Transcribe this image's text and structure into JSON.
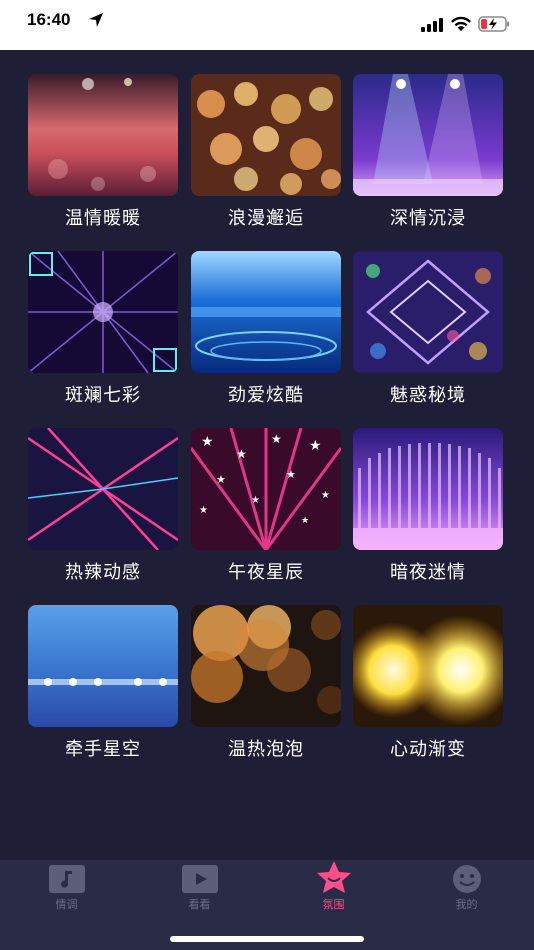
{
  "status_bar": {
    "time": "16:40"
  },
  "scenes": [
    {
      "label": "温情暖暖",
      "theme": "warm-pink-bokeh"
    },
    {
      "label": "浪漫邂逅",
      "theme": "golden-bokeh"
    },
    {
      "label": "深情沉浸",
      "theme": "purple-stage"
    },
    {
      "label": "斑斓七彩",
      "theme": "violet-laser"
    },
    {
      "label": "劲爱炫酷",
      "theme": "blue-stage"
    },
    {
      "label": "魅惑秘境",
      "theme": "neon-diamond"
    },
    {
      "label": "热辣动感",
      "theme": "pink-laser-tunnel"
    },
    {
      "label": "午夜星辰",
      "theme": "star-tunnel"
    },
    {
      "label": "暗夜迷情",
      "theme": "violet-dots"
    },
    {
      "label": "牵手星空",
      "theme": "blue-glow"
    },
    {
      "label": "温热泡泡",
      "theme": "amber-bubbles"
    },
    {
      "label": "心动渐变",
      "theme": "yellow-light"
    }
  ],
  "tabbar": {
    "items": [
      {
        "label": "情调",
        "icon": "music-note-icon",
        "active": false
      },
      {
        "label": "看看",
        "icon": "play-icon",
        "active": false
      },
      {
        "label": "氛围",
        "icon": "star-icon",
        "active": true
      },
      {
        "label": "我的",
        "icon": "smiley-icon",
        "active": false
      }
    ]
  },
  "colors": {
    "background": "#1e1f36",
    "tabbar": "#2a2b47",
    "active": "#ff4e8a",
    "inactive": "#6c6e88"
  }
}
